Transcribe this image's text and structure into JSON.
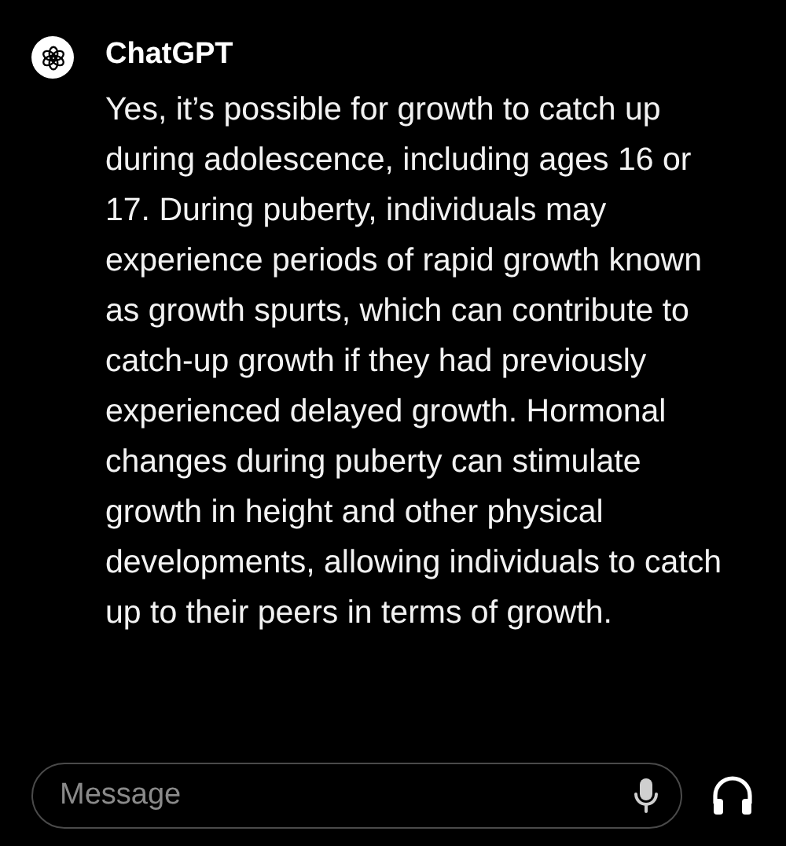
{
  "message": {
    "author": "ChatGPT",
    "text": "Yes, it’s possible for growth to catch up during adolescence, including ages 16 or 17. During puberty, individuals may experience periods of rapid growth known as growth spurts, which can contribute to catch-up growth if they had previously experienced delayed growth. Hormonal changes during puberty can stimulate growth in height and other physical developments, allowing individuals to catch up to their peers in terms of growth."
  },
  "composer": {
    "placeholder": "Message"
  }
}
